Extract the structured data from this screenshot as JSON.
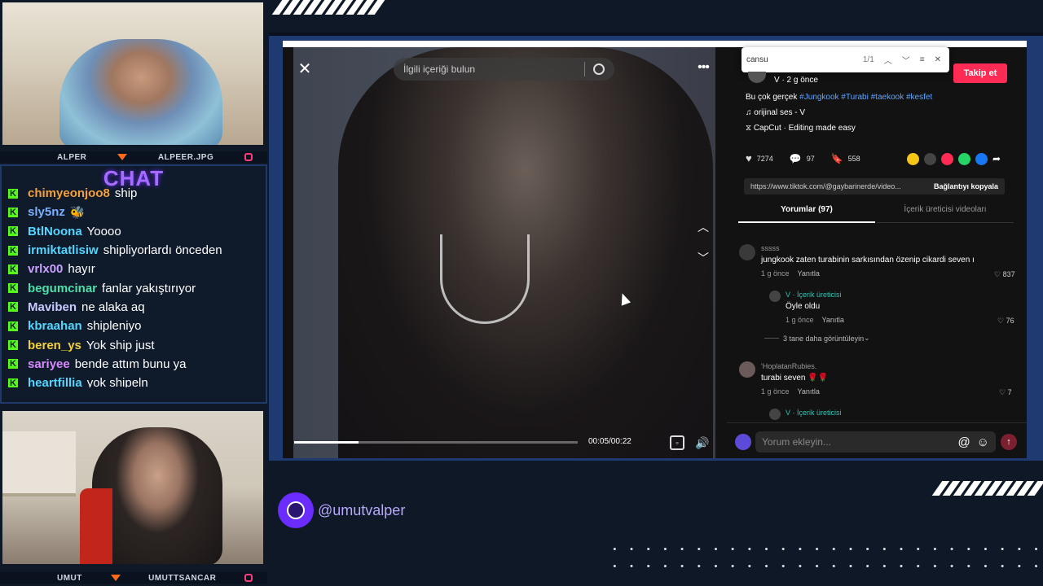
{
  "cams": {
    "top": {
      "left_label": "ALPER",
      "right_label": "ALPEER.JPG"
    },
    "bottom": {
      "left_label": "UMUT",
      "right_label": "UMUTTSANCAR"
    }
  },
  "chat": {
    "title": "CHAT",
    "messages": [
      {
        "user": "chimyeonjoo8",
        "text": "ship",
        "color": "#f4a13b"
      },
      {
        "user": "sly5nz",
        "text": "🐝",
        "color": "#7ab0ff"
      },
      {
        "user": "BtlNoona",
        "text": "Yoooo",
        "color": "#53d6ff"
      },
      {
        "user": "irmiktatlisiw",
        "text": "shipliyorlardı önceden",
        "color": "#53d6ff"
      },
      {
        "user": "vrlx00",
        "text": "hayır",
        "color": "#c9a0ff"
      },
      {
        "user": "begumcinar",
        "text": "fanlar yakıştırıyor",
        "color": "#4ee0a8"
      },
      {
        "user": "Maviben",
        "text": "ne alaka aq",
        "color": "#c9c9ff"
      },
      {
        "user": "kbraahan",
        "text": "shipleniyo",
        "color": "#53d6ff"
      },
      {
        "user": "beren_ys",
        "text": "Yok ship just",
        "color": "#f4d13b"
      },
      {
        "user": "sariyee",
        "text": "bende attım bunu ya",
        "color": "#d88bff"
      },
      {
        "user": "heartfillia",
        "text": "yok shipeln",
        "color": "#53d6ff"
      }
    ]
  },
  "video": {
    "search_placeholder": "İlgili içeriği bulun",
    "time": "00:05/00:22",
    "progress": 0.227
  },
  "find_bar": {
    "query": "cansu",
    "count": "1/1"
  },
  "post": {
    "author_meta": "V · 2 g önce",
    "follow_label": "Takip et",
    "caption": "Bu çok gerçek",
    "hashtags": "#Jungkook #Turabi #taekook #kesfet",
    "sound": "orijinal ses - V",
    "capcut": "CapCut · Editing made easy",
    "likes": "7274",
    "comments": "97",
    "saves": "558",
    "link": "https://www.tiktok.com/@gaybarinerde/video...",
    "copy_link_label": "Bağlantıyı kopyala",
    "tab_comments": "Yorumlar (97)",
    "tab_creator": "İçerik üreticisi videoları"
  },
  "comments": [
    {
      "user": "sssss",
      "text": "jungkook zaten turabinin sarkısından özenip cikardi seven ı",
      "meta": "1 g önce",
      "reply": "Yanıtla",
      "likes": "837"
    },
    {
      "user": "V · İçerik üreticisi",
      "text": "Öyle oldu",
      "meta": "1 g önce",
      "reply": "Yanıtla",
      "likes": "76"
    },
    {
      "more": "3 tane daha görüntüleyin"
    },
    {
      "user": "'HoplatanRubies.",
      "text": "turabi seven 🌹🌹",
      "meta": "1 g önce",
      "reply": "Yanıtla",
      "likes": "7"
    },
    {
      "user": "V · İçerik üreticisi",
      "text": "",
      "meta": "",
      "reply": "",
      "likes": ""
    }
  ],
  "comment_input_placeholder": "Yorum ekleyin...",
  "social_handle": "@umutvalper",
  "colors": {
    "accent": "#fe2c55",
    "kick": "#53fc18",
    "chat_title": "#a66cff",
    "frame": "#1f3a6a"
  }
}
